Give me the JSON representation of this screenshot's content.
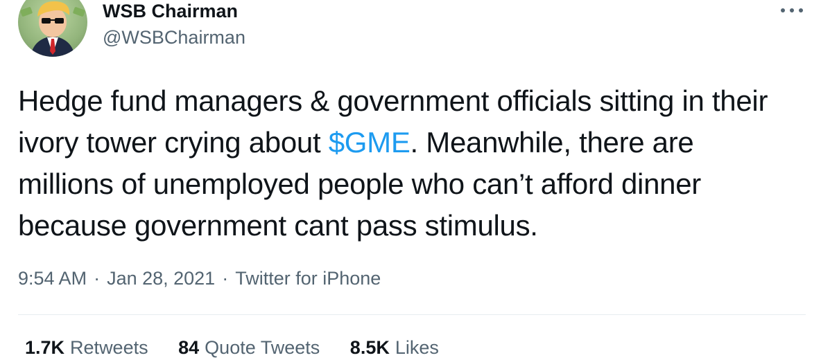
{
  "author": {
    "display_name": "WSB Chairman",
    "handle": "@WSBChairman",
    "avatar_icon": "wsb-chairman-avatar-icon"
  },
  "menu_icon": "more-options-icon",
  "tweet": {
    "text_before": "Hedge fund managers & government officials sitting in their ivory tower crying about ",
    "cashtag": "$GME",
    "text_after": ". Meanwhile, there are millions of unemployed people who can’t afford dinner because government cant pass stimulus."
  },
  "meta": {
    "time": "9:54 AM",
    "separator": "·",
    "date": "Jan 28, 2021",
    "source": "Twitter for iPhone"
  },
  "stats": {
    "retweets_count": "1.7K",
    "retweets_label": "Retweets",
    "quotes_count": "84",
    "quotes_label": "Quote Tweets",
    "likes_count": "8.5K",
    "likes_label": "Likes"
  },
  "colors": {
    "link": "#1d9bf0",
    "text": "#0f1419",
    "secondary": "#536471",
    "divider": "#e6ecf0"
  }
}
